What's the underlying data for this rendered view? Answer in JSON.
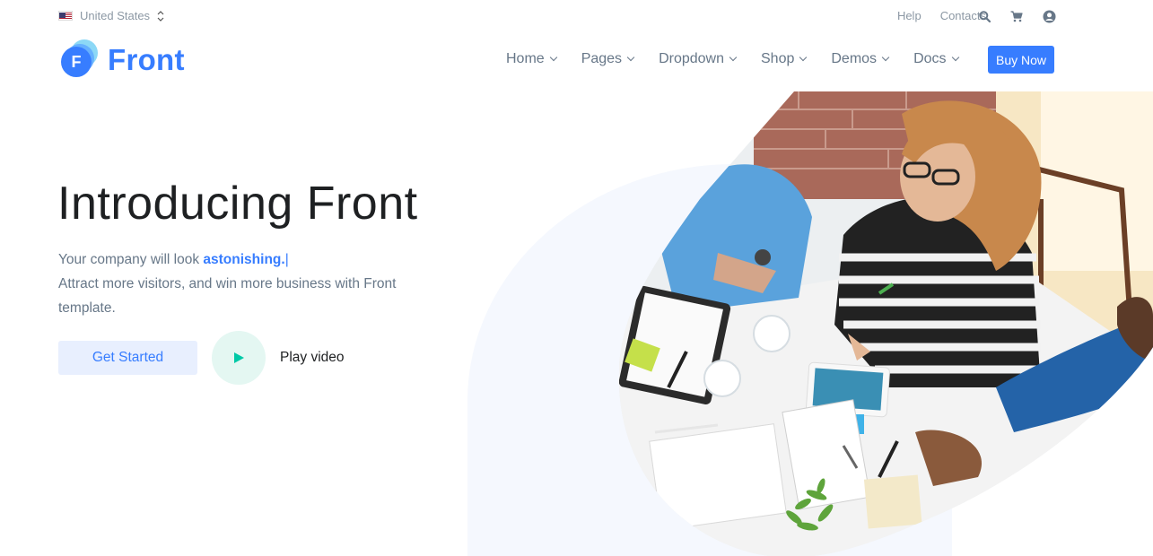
{
  "topbar": {
    "language": "United States",
    "links": [
      "Help",
      "Contacts"
    ],
    "icons": [
      "search-icon",
      "cart-icon",
      "user-account-icon"
    ]
  },
  "header": {
    "brand": "Front",
    "logo_letter": "F",
    "nav": [
      "Home",
      "Pages",
      "Dropdown",
      "Shop",
      "Demos",
      "Docs"
    ],
    "cta": "Buy Now"
  },
  "hero": {
    "title": "Introducing Front",
    "line1_prefix": "Your company will look",
    "line1_accent": "astonishing.",
    "line1_cursor": "|",
    "line2": "Attract more visitors, and win more business with Front template.",
    "primary_button": "Get Started",
    "video_label": "Play video"
  },
  "colors": {
    "primary": "#377dff",
    "primary_soft": "#e8effe",
    "teal": "#00c9a7",
    "teal_soft": "#e4f7f2",
    "muted_text": "#677788",
    "blob": "#f5f8fe"
  }
}
